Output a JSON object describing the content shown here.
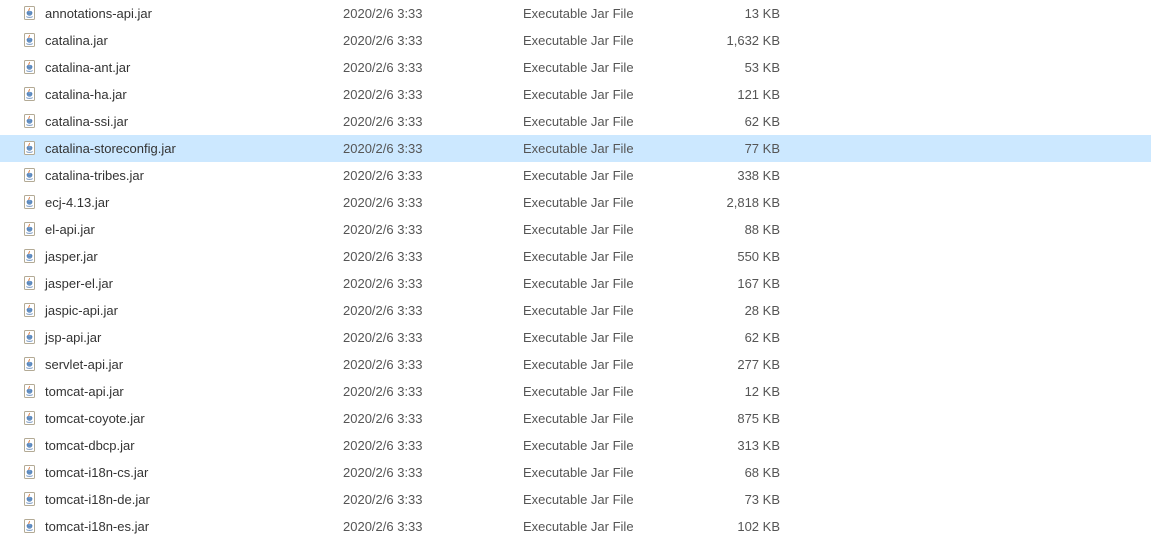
{
  "files": [
    {
      "name": "annotations-api.jar",
      "date": "2020/2/6 3:33",
      "type": "Executable Jar File",
      "size": "13 KB",
      "selected": false
    },
    {
      "name": "catalina.jar",
      "date": "2020/2/6 3:33",
      "type": "Executable Jar File",
      "size": "1,632 KB",
      "selected": false
    },
    {
      "name": "catalina-ant.jar",
      "date": "2020/2/6 3:33",
      "type": "Executable Jar File",
      "size": "53 KB",
      "selected": false
    },
    {
      "name": "catalina-ha.jar",
      "date": "2020/2/6 3:33",
      "type": "Executable Jar File",
      "size": "121 KB",
      "selected": false
    },
    {
      "name": "catalina-ssi.jar",
      "date": "2020/2/6 3:33",
      "type": "Executable Jar File",
      "size": "62 KB",
      "selected": false
    },
    {
      "name": "catalina-storeconfig.jar",
      "date": "2020/2/6 3:33",
      "type": "Executable Jar File",
      "size": "77 KB",
      "selected": true
    },
    {
      "name": "catalina-tribes.jar",
      "date": "2020/2/6 3:33",
      "type": "Executable Jar File",
      "size": "338 KB",
      "selected": false
    },
    {
      "name": "ecj-4.13.jar",
      "date": "2020/2/6 3:33",
      "type": "Executable Jar File",
      "size": "2,818 KB",
      "selected": false
    },
    {
      "name": "el-api.jar",
      "date": "2020/2/6 3:33",
      "type": "Executable Jar File",
      "size": "88 KB",
      "selected": false
    },
    {
      "name": "jasper.jar",
      "date": "2020/2/6 3:33",
      "type": "Executable Jar File",
      "size": "550 KB",
      "selected": false
    },
    {
      "name": "jasper-el.jar",
      "date": "2020/2/6 3:33",
      "type": "Executable Jar File",
      "size": "167 KB",
      "selected": false
    },
    {
      "name": "jaspic-api.jar",
      "date": "2020/2/6 3:33",
      "type": "Executable Jar File",
      "size": "28 KB",
      "selected": false
    },
    {
      "name": "jsp-api.jar",
      "date": "2020/2/6 3:33",
      "type": "Executable Jar File",
      "size": "62 KB",
      "selected": false
    },
    {
      "name": "servlet-api.jar",
      "date": "2020/2/6 3:33",
      "type": "Executable Jar File",
      "size": "277 KB",
      "selected": false
    },
    {
      "name": "tomcat-api.jar",
      "date": "2020/2/6 3:33",
      "type": "Executable Jar File",
      "size": "12 KB",
      "selected": false
    },
    {
      "name": "tomcat-coyote.jar",
      "date": "2020/2/6 3:33",
      "type": "Executable Jar File",
      "size": "875 KB",
      "selected": false
    },
    {
      "name": "tomcat-dbcp.jar",
      "date": "2020/2/6 3:33",
      "type": "Executable Jar File",
      "size": "313 KB",
      "selected": false
    },
    {
      "name": "tomcat-i18n-cs.jar",
      "date": "2020/2/6 3:33",
      "type": "Executable Jar File",
      "size": "68 KB",
      "selected": false
    },
    {
      "name": "tomcat-i18n-de.jar",
      "date": "2020/2/6 3:33",
      "type": "Executable Jar File",
      "size": "73 KB",
      "selected": false
    },
    {
      "name": "tomcat-i18n-es.jar",
      "date": "2020/2/6 3:33",
      "type": "Executable Jar File",
      "size": "102 KB",
      "selected": false
    }
  ]
}
